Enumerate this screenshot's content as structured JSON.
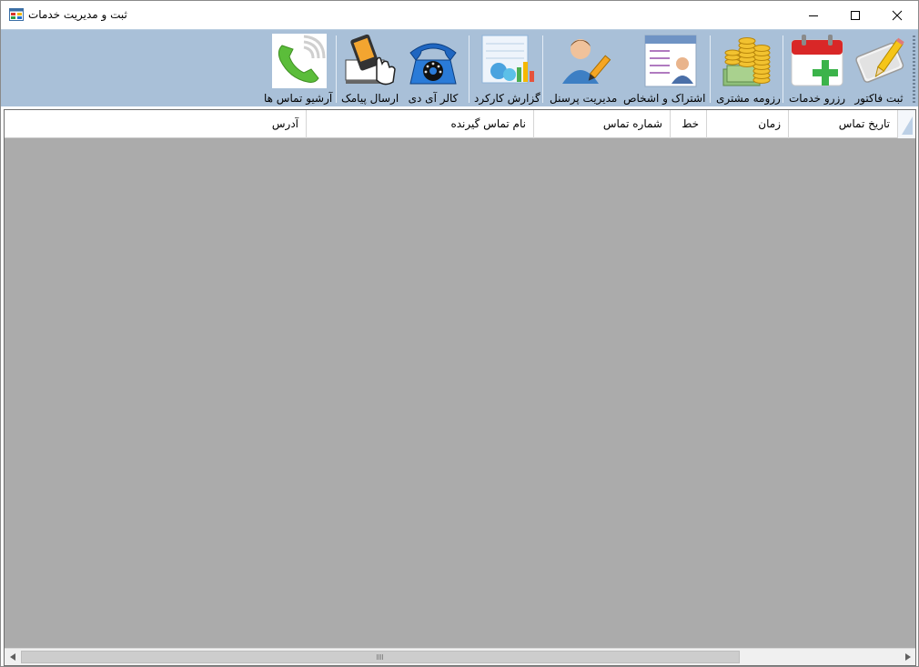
{
  "window": {
    "title": "ثبت و مدیریت خدمات"
  },
  "toolbar": {
    "items": [
      {
        "label": "ثبت فاکتور",
        "icon": "invoice-pencil-icon"
      },
      {
        "label": "رزرو خدمات",
        "icon": "calendar-add-icon"
      },
      {
        "label": "رزومه مشتری",
        "icon": "coins-money-icon"
      },
      {
        "label": "اشتراک و اشخاص",
        "icon": "contact-card-icon"
      },
      {
        "label": "مدیریت پرسنل",
        "icon": "user-edit-icon"
      },
      {
        "label": "گزارش کارکرد",
        "icon": "report-chart-icon"
      },
      {
        "label": "کالر آی دی",
        "icon": "telephone-icon"
      },
      {
        "label": "ارسال پیامک",
        "icon": "mobile-touch-icon"
      },
      {
        "label": "آرشیو تماس ها",
        "icon": "phone-call-icon"
      }
    ]
  },
  "grid": {
    "columns": [
      "تاریخ تماس",
      "زمان",
      "خط",
      "شماره تماس",
      "نام تماس گیرنده",
      "آدرس"
    ],
    "rows": []
  },
  "colors": {
    "toolbar_bg": "#a9c0d8",
    "grid_bg": "#ababab",
    "header_bg": "#ffffff"
  }
}
